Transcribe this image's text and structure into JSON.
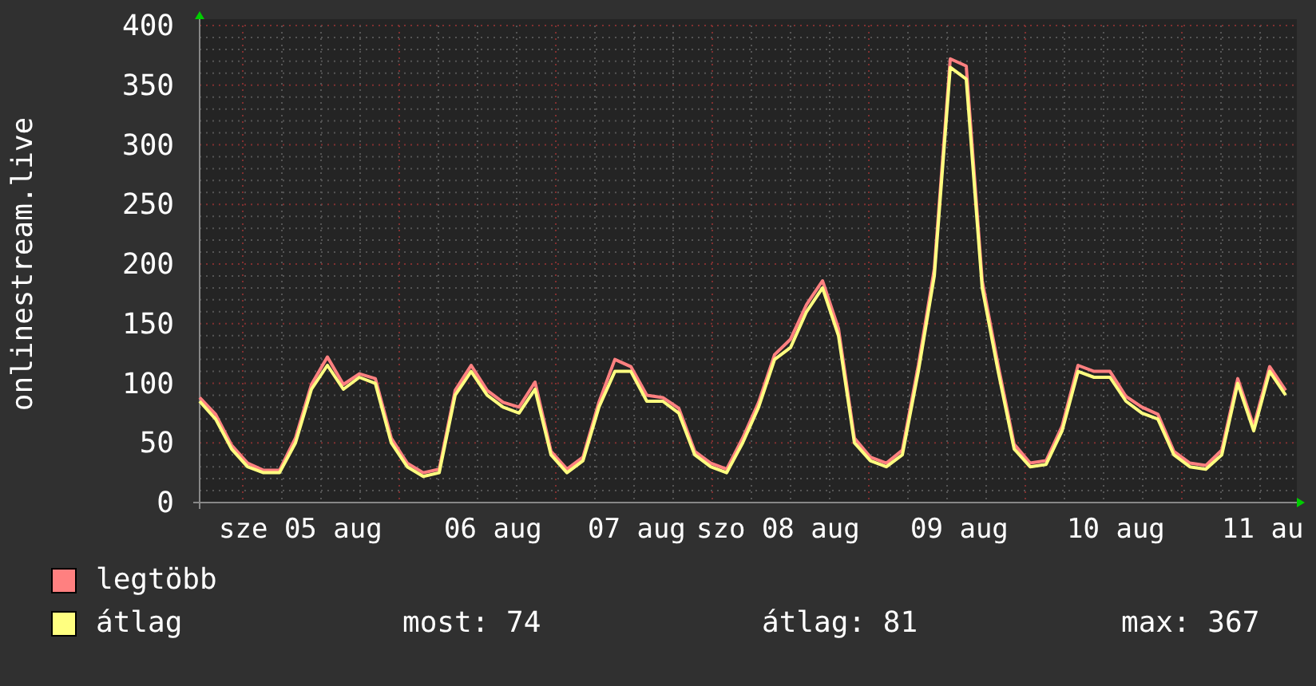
{
  "chart_data": {
    "type": "line",
    "ylabel": "onlinestream.live",
    "ylim": [
      0,
      400
    ],
    "yticks": [
      0,
      50,
      100,
      150,
      200,
      250,
      300,
      350,
      400
    ],
    "grid": true,
    "series": [
      {
        "name": "legtöbb",
        "color": "#ff8080",
        "values": [
          88,
          74,
          48,
          33,
          27,
          27,
          54,
          99,
          122,
          99,
          108,
          104,
          54,
          33,
          25,
          28,
          94,
          115,
          94,
          84,
          80,
          101,
          43,
          28,
          38,
          84,
          120,
          114,
          90,
          88,
          79,
          43,
          33,
          28,
          54,
          84,
          124,
          137,
          166,
          186,
          146,
          54,
          38,
          33,
          44,
          115,
          196,
          372,
          366,
          186,
          115,
          49,
          33,
          35,
          64,
          115,
          110,
          110,
          89,
          80,
          74,
          43,
          33,
          31,
          44,
          104,
          64,
          114,
          94
        ]
      },
      {
        "name": "átlag",
        "color": "#ffff80",
        "values": [
          85,
          70,
          45,
          30,
          25,
          25,
          50,
          95,
          115,
          95,
          105,
          100,
          50,
          30,
          22,
          25,
          90,
          110,
          90,
          80,
          75,
          95,
          40,
          25,
          35,
          80,
          110,
          110,
          85,
          85,
          75,
          40,
          30,
          25,
          50,
          80,
          120,
          130,
          160,
          180,
          140,
          50,
          35,
          30,
          40,
          110,
          190,
          365,
          355,
          180,
          110,
          45,
          30,
          32,
          60,
          110,
          105,
          105,
          85,
          75,
          70,
          40,
          30,
          28,
          40,
          100,
          60,
          110,
          90
        ]
      }
    ]
  },
  "x_axis_labels": [
    "sze 05 aug",
    "06 aug",
    "07 aug",
    "szo 08 aug",
    "09 aug",
    "10 aug",
    "11 au"
  ],
  "stats": [
    {
      "label": "most: 74"
    },
    {
      "label": "átlag: 81"
    },
    {
      "label": "max: 367"
    }
  ]
}
